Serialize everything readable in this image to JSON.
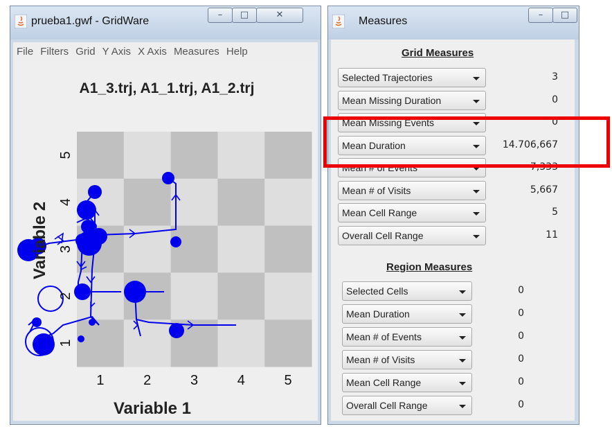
{
  "gridware": {
    "title": "prueba1.gwf - GridWare",
    "menu": [
      "File",
      "Filters",
      "Grid",
      "Y Axis",
      "X Axis",
      "Measures",
      "Help"
    ],
    "buttons": {
      "minimize": "–",
      "maximize": "□",
      "close": "✕"
    },
    "plot": {
      "title": "A1_3.trj, A1_1.trj, A1_2.trj",
      "xlabel": "Variable 1",
      "ylabel": "Variable 2",
      "xticks": [
        "1",
        "2",
        "3",
        "4",
        "5"
      ],
      "yticks": [
        "1",
        "2",
        "3",
        "4",
        "5"
      ]
    }
  },
  "measures": {
    "title": "Measures",
    "buttons": {
      "minimize": "–",
      "maximize": "□"
    },
    "grid_header": "Grid Measures",
    "grid_rows": [
      {
        "label": "Selected Trajectories",
        "value": "3"
      },
      {
        "label": "Mean Missing Duration",
        "value": "0"
      },
      {
        "label": "Mean Missing Events",
        "value": "0"
      },
      {
        "label": "Mean Duration",
        "value": "14.706,667"
      },
      {
        "label": "Mean # of Events",
        "value": "7,333"
      },
      {
        "label": "Mean # of Visits",
        "value": "5,667"
      },
      {
        "label": "Mean Cell Range",
        "value": "5"
      },
      {
        "label": "Overall Cell Range",
        "value": "11"
      }
    ],
    "region_header": "Region Measures",
    "region_rows": [
      {
        "label": "Selected Cells",
        "value": "0"
      },
      {
        "label": "Mean Duration",
        "value": "0"
      },
      {
        "label": "Mean # of Events",
        "value": "0"
      },
      {
        "label": "Mean # of Visits",
        "value": "0"
      },
      {
        "label": "Mean Cell Range",
        "value": "0"
      },
      {
        "label": "Overall Cell Range",
        "value": "0"
      }
    ]
  },
  "colors": {
    "trajectory": "#0000ee",
    "highlight": "#ee0000",
    "cell_dark": "#c0c0c0",
    "cell_light": "#dedede"
  }
}
